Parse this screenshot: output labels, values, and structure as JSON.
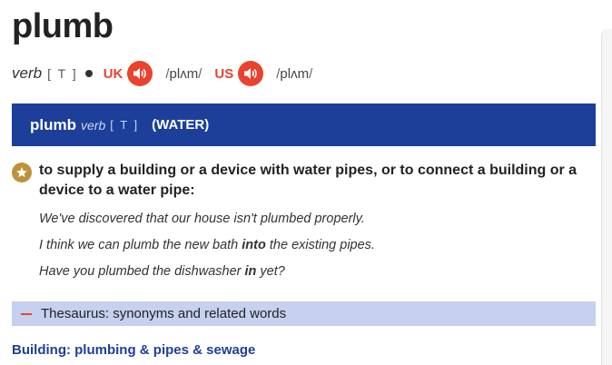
{
  "entry": {
    "headword": "plumb",
    "pos": "verb",
    "grammar": "[ T ]",
    "uk": {
      "label": "UK",
      "ipa": "plʌm"
    },
    "us": {
      "label": "US",
      "ipa": "plʌm"
    }
  },
  "sense": {
    "word": "plumb",
    "pos": "verb",
    "grammar": "[ T ]",
    "guideword": "(WATER)",
    "definition": "to supply a building or a device with water pipes, or to connect a building or a device to a water pipe:",
    "examples": [
      {
        "before": "We've discovered that our house isn't plumbed properly.",
        "bold": "",
        "after": ""
      },
      {
        "before": "I think we can plumb the new bath ",
        "bold": "into",
        "after": " the existing pipes."
      },
      {
        "before": "Have you plumbed the dishwasher ",
        "bold": "in",
        "after": " yet?"
      }
    ],
    "thesaurus_label": "Thesaurus: synonyms and related words",
    "topic_link": "Building: plumbing & pipes & sewage"
  },
  "icons": {
    "speaker": "speaker-icon",
    "star": "star-icon",
    "collapse": "minus-icon"
  },
  "colors": {
    "accent": "#e8432f",
    "sense_bar": "#1d3f9a",
    "thesaurus_bar": "#c5d1ee",
    "star_badge": "#c0913a"
  }
}
